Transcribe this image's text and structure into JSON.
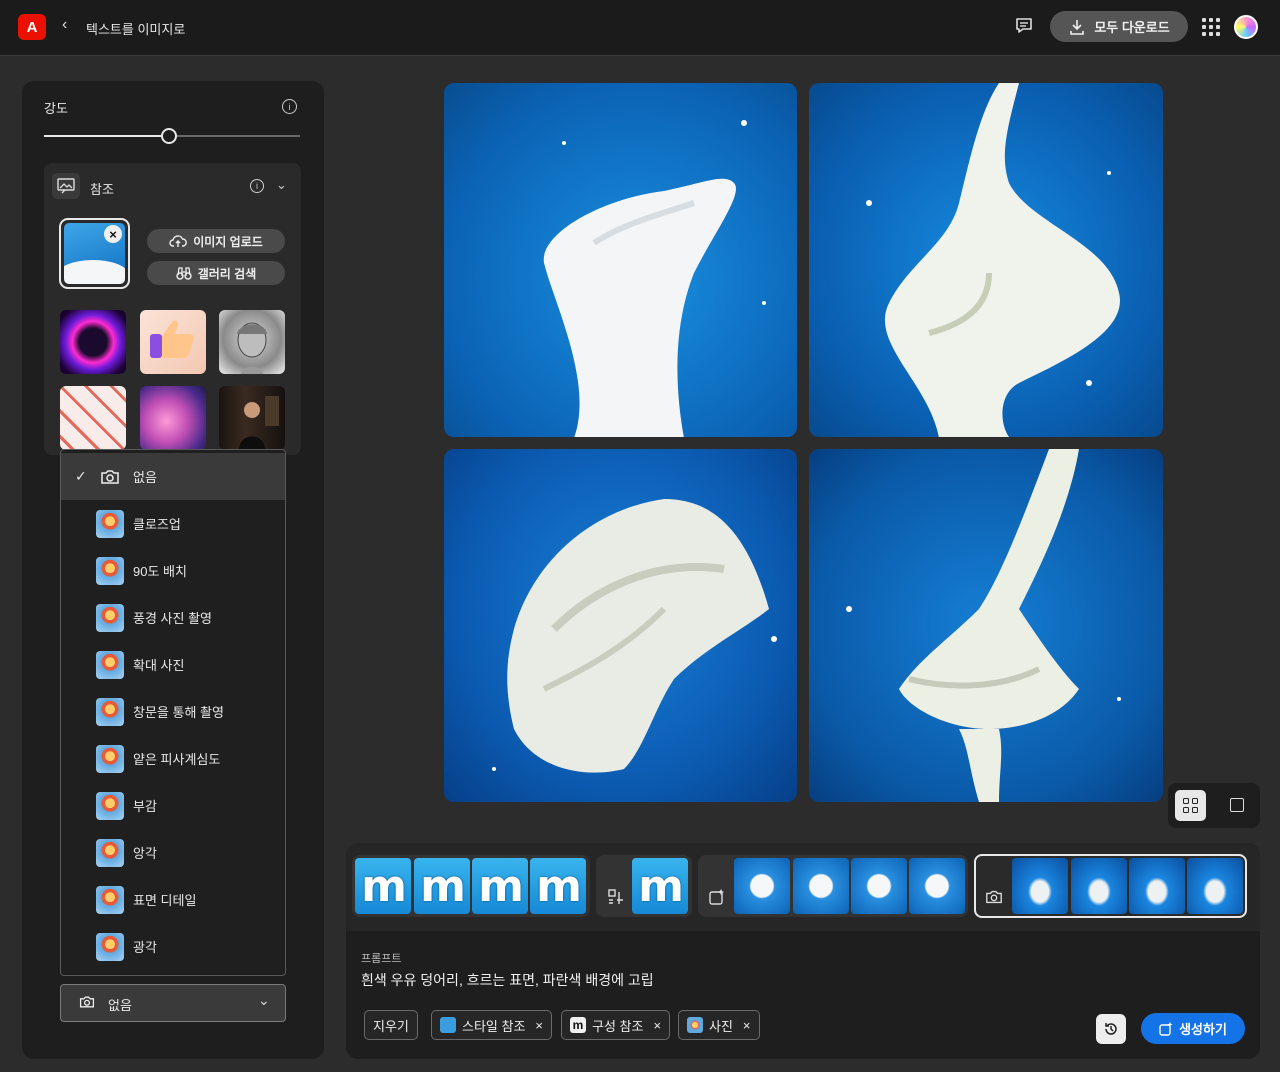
{
  "header": {
    "app_title": "텍스트를 이미지로",
    "download_all_label": "모두 다운로드"
  },
  "left_panel": {
    "strength_label": "강도",
    "strength_value": 0.49,
    "reference": {
      "label": "참조",
      "upload_label": "이미지 업로드",
      "gallery_label": "갤러리 검색"
    },
    "camera_menu": {
      "items": [
        {
          "label": "없음",
          "selected": true
        },
        {
          "label": "클로즈업"
        },
        {
          "label": "90도 배치"
        },
        {
          "label": "풍경 사진 촬영"
        },
        {
          "label": "확대 사진"
        },
        {
          "label": "창문을 통해 촬영"
        },
        {
          "label": "얕은 피사계심도"
        },
        {
          "label": "부감"
        },
        {
          "label": "앙각"
        },
        {
          "label": "표면 디테일"
        },
        {
          "label": "광각"
        }
      ],
      "selected_value": "없음"
    }
  },
  "prompt": {
    "label": "프롬프트",
    "text": "흰색 우유 덩어리, 흐르는 표면, 파란색 배경에 고립"
  },
  "chips": {
    "clear_label": "지우기",
    "style_ref_label": "스타일 참조",
    "composition_ref_label": "구성 참조",
    "photo_label": "사진"
  },
  "generate_label": "생성하기",
  "icons": {
    "logo": "A"
  },
  "colors": {
    "accent": "#1473e6",
    "brand": "#eb1000"
  }
}
